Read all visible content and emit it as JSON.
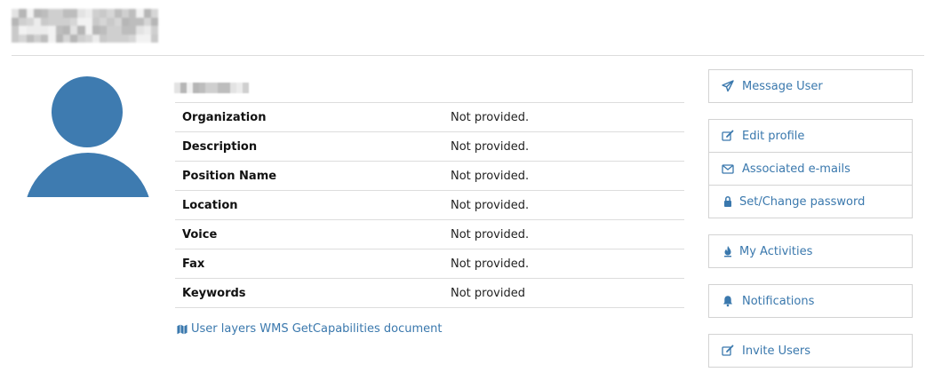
{
  "profile": {
    "rows": [
      {
        "label": "Organization",
        "value": "Not provided."
      },
      {
        "label": "Description",
        "value": "Not provided."
      },
      {
        "label": "Position Name",
        "value": "Not provided."
      },
      {
        "label": "Location",
        "value": "Not provided."
      },
      {
        "label": "Voice",
        "value": "Not provided."
      },
      {
        "label": "Fax",
        "value": "Not provided."
      },
      {
        "label": "Keywords",
        "value": "Not provided"
      }
    ],
    "wms_link": "User layers WMS GetCapabilities document"
  },
  "actions": {
    "message_user": "Message User",
    "edit_profile": "Edit profile",
    "associated_emails": "Associated e-mails",
    "set_password": "Set/Change password",
    "my_activities": "My Activities",
    "notifications": "Notifications",
    "invite_users": "Invite Users"
  },
  "colors": {
    "accent": "#3a78ad",
    "avatar": "#3e7bb0",
    "border": "#d3d3d3"
  },
  "icons": {
    "message_user": "paper-plane-icon",
    "edit_profile": "edit-icon",
    "associated_emails": "envelope-icon",
    "set_password": "lock-icon",
    "my_activities": "fire-icon",
    "notifications": "bell-icon",
    "invite_users": "edit-icon",
    "wms_link": "map-icon"
  }
}
